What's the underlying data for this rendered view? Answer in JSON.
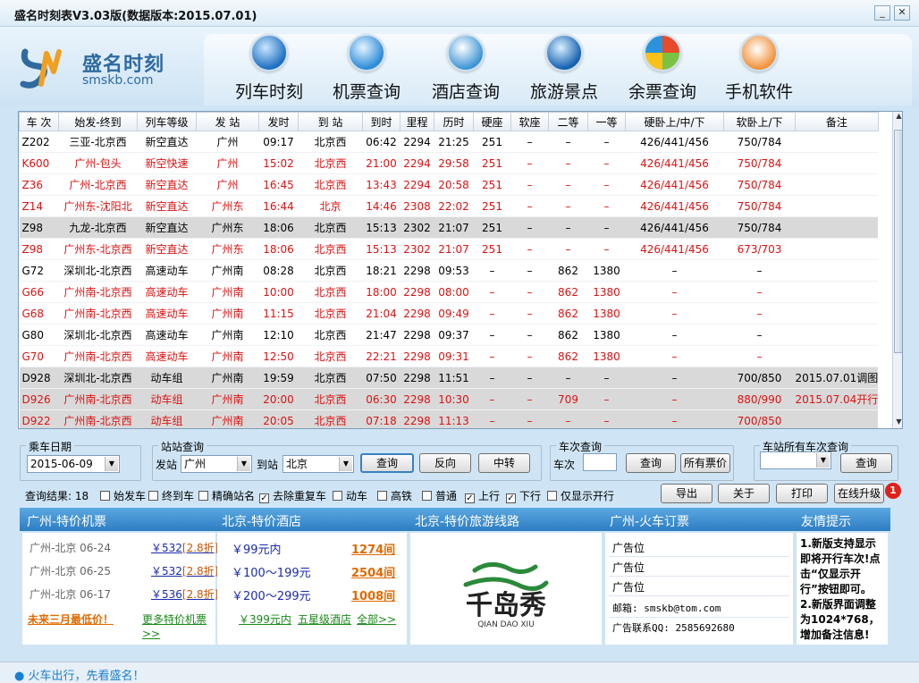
{
  "window": {
    "title": "盛名时刻表V3.03版(数据版本:2015.07.01)"
  },
  "logo": {
    "cn": "盛名时刻",
    "en": "smskb.com"
  },
  "nav": [
    {
      "label": "列车时刻",
      "icon": "train-icon"
    },
    {
      "label": "机票查询",
      "icon": "airplane-icon"
    },
    {
      "label": "酒店查询",
      "icon": "hotel-bell-icon"
    },
    {
      "label": "旅游景点",
      "icon": "globe-icon"
    },
    {
      "label": "余票查询",
      "icon": "windows-icon"
    },
    {
      "label": "手机软件",
      "icon": "java-icon"
    }
  ],
  "table": {
    "headers": [
      "车 次",
      "始发-终到",
      "列车等级",
      "发 站",
      "发时",
      "到 站",
      "到时",
      "里程",
      "历时",
      "硬座",
      "软座",
      "二等",
      "一等",
      "硬卧上/中/下",
      "软卧上/下",
      "备注"
    ],
    "rows": [
      {
        "style": "",
        "cells": [
          "Z202",
          "三亚-北京西",
          "新空直达",
          "广州",
          "09:17",
          "北京西",
          "06:42",
          "2294",
          "21:25",
          "251",
          "–",
          "–",
          "–",
          "426/441/456",
          "750/784",
          ""
        ]
      },
      {
        "style": "r",
        "cells": [
          "K600",
          "广州-包头",
          "新空快速",
          "广州",
          "15:02",
          "北京西",
          "21:00",
          "2294",
          "29:58",
          "251",
          "–",
          "–",
          "–",
          "426/441/456",
          "750/784",
          ""
        ]
      },
      {
        "style": "r",
        "cells": [
          "Z36",
          "广州-北京西",
          "新空直达",
          "广州",
          "16:45",
          "北京西",
          "13:43",
          "2294",
          "20:58",
          "251",
          "–",
          "–",
          "–",
          "426/441/456",
          "750/784",
          ""
        ]
      },
      {
        "style": "r",
        "cells": [
          "Z14",
          "广州东-沈阳北",
          "新空直达",
          "广州东",
          "16:44",
          "北京",
          "14:46",
          "2308",
          "22:02",
          "251",
          "–",
          "–",
          "–",
          "426/441/456",
          "750/784",
          ""
        ]
      },
      {
        "style": "g",
        "cells": [
          "Z98",
          "九龙-北京西",
          "新空直达",
          "广州东",
          "18:06",
          "北京西",
          "15:13",
          "2302",
          "21:07",
          "251",
          "–",
          "–",
          "–",
          "426/441/456",
          "750/784",
          ""
        ]
      },
      {
        "style": "r",
        "cells": [
          "Z98",
          "广州东-北京西",
          "新空直达",
          "广州东",
          "18:06",
          "北京西",
          "15:13",
          "2302",
          "21:07",
          "251",
          "–",
          "–",
          "–",
          "426/441/456",
          "673/703",
          ""
        ]
      },
      {
        "style": "",
        "cells": [
          "G72",
          "深圳北-北京西",
          "高速动车",
          "广州南",
          "08:28",
          "北京西",
          "18:21",
          "2298",
          "09:53",
          "–",
          "–",
          "862",
          "1380",
          "–",
          "–",
          ""
        ]
      },
      {
        "style": "r",
        "cells": [
          "G66",
          "广州南-北京西",
          "高速动车",
          "广州南",
          "10:00",
          "北京西",
          "18:00",
          "2298",
          "08:00",
          "–",
          "–",
          "862",
          "1380",
          "–",
          "–",
          ""
        ]
      },
      {
        "style": "r",
        "cells": [
          "G68",
          "广州南-北京西",
          "高速动车",
          "广州南",
          "11:15",
          "北京西",
          "21:04",
          "2298",
          "09:49",
          "–",
          "–",
          "862",
          "1380",
          "–",
          "–",
          ""
        ]
      },
      {
        "style": "",
        "cells": [
          "G80",
          "深圳北-北京西",
          "高速动车",
          "广州南",
          "12:10",
          "北京西",
          "21:47",
          "2298",
          "09:37",
          "–",
          "–",
          "862",
          "1380",
          "–",
          "–",
          ""
        ]
      },
      {
        "style": "r",
        "cells": [
          "G70",
          "广州南-北京西",
          "高速动车",
          "广州南",
          "12:50",
          "北京西",
          "22:21",
          "2298",
          "09:31",
          "–",
          "–",
          "862",
          "1380",
          "–",
          "–",
          ""
        ]
      },
      {
        "style": "g",
        "cells": [
          "D928",
          "深圳北-北京西",
          "动车组",
          "广州南",
          "19:59",
          "北京西",
          "07:50",
          "2298",
          "11:51",
          "–",
          "–",
          "–",
          "–",
          "–",
          "700/850",
          "2015.07.01调图"
        ]
      },
      {
        "style": "g r",
        "cells": [
          "D926",
          "广州南-北京西",
          "动车组",
          "广州南",
          "20:00",
          "北京西",
          "06:30",
          "2298",
          "10:30",
          "–",
          "–",
          "709",
          "–",
          "–",
          "880/990",
          "2015.07.04开行"
        ]
      },
      {
        "style": "g r",
        "cells": [
          "D922",
          "广州南-北京西",
          "动车组",
          "广州南",
          "20:05",
          "北京西",
          "07:18",
          "2298",
          "11:13",
          "–",
          "–",
          "–",
          "–",
          "–",
          "700/850",
          ""
        ]
      }
    ]
  },
  "controls": {
    "date_group": "乘车日期",
    "date_value": "2015-06-09",
    "station_group": "站站查询",
    "from_label": "发站",
    "from_value": "广州",
    "to_label": "到站",
    "to_value": "北京",
    "query_btn": "查询",
    "reverse_btn": "反向",
    "transfer_btn": "中转",
    "train_group": "车次查询",
    "train_label": "车次",
    "train_query_btn": "查询",
    "all_fares_btn": "所有票价",
    "station_all_group": "车站所有车次查询",
    "station_all_query_btn": "查询"
  },
  "filters": {
    "result_label": "查询结果: 18",
    "options": [
      {
        "label": "始发车",
        "checked": false
      },
      {
        "label": "终到车",
        "checked": false
      },
      {
        "label": "精确站名",
        "checked": false
      },
      {
        "label": "去除重复车",
        "checked": true
      },
      {
        "label": "动车",
        "checked": false
      },
      {
        "label": "高铁",
        "checked": false
      },
      {
        "label": "普通",
        "checked": false
      },
      {
        "label": "上行",
        "checked": true
      },
      {
        "label": "下行",
        "checked": true
      },
      {
        "label": "仅显示开行",
        "checked": false
      }
    ],
    "export_btn": "导出",
    "about_btn": "关于",
    "print_btn": "打印",
    "upgrade_btn": "在线升级",
    "upgrade_badge": "1"
  },
  "panels": {
    "flights": {
      "title": "广州-特价机票",
      "items": [
        {
          "route": "广州-北京  06-24",
          "price": "￥532",
          "disc": "[2.8折]"
        },
        {
          "route": "广州-北京  06-25",
          "price": "￥532",
          "disc": "[2.8折]"
        },
        {
          "route": "广州-北京  06-17",
          "price": "￥536",
          "disc": "[2.8折]"
        }
      ],
      "promo": "未来三月最低价！",
      "more": "更多特价机票",
      "more2": ">>"
    },
    "hotels": {
      "title": "北京-特价酒店",
      "items": [
        {
          "price": "￥99元内",
          "count": "1274间"
        },
        {
          "price": "￥100～199元",
          "count": "2504间"
        },
        {
          "price": "￥200～299元",
          "count": "1008间"
        }
      ],
      "links": [
        "￥399元内",
        "五星级酒店",
        "全部>>"
      ]
    },
    "travel": {
      "title": "北京-特价旅游线路",
      "brand_cn": "千岛秀",
      "brand_en": "QIAN DAO XIU"
    },
    "tickets": {
      "title": "广州-火车订票",
      "lines": [
        "广告位",
        "广告位",
        "广告位",
        "邮箱: smskb@tom.com",
        "广告联系QQ: 2585692680"
      ]
    },
    "tips": {
      "title": "友情提示",
      "text": "1.新版支持显示即将开行车次!点击“仅显示开行”按钮即可。2.新版界面调整为1024*768，增加备注信息!"
    }
  },
  "status": {
    "text": "火车出行，先看盛名！"
  },
  "colors": {
    "accent": "#2d7dc3",
    "red_row": "#d11111",
    "gray_row": "#d9d9d9",
    "background": "#cfe5f6"
  }
}
